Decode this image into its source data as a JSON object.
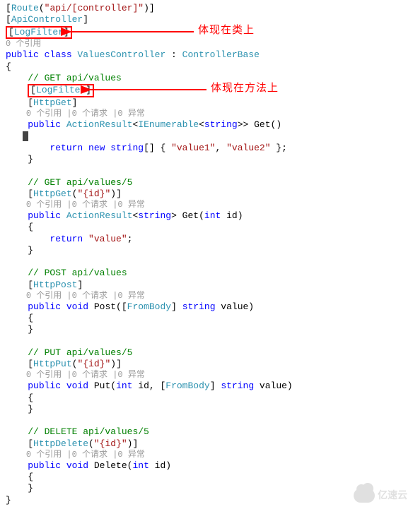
{
  "annotations": {
    "class_level": "体现在类上",
    "method_level": "体现在方法上"
  },
  "watermark": "亿速云",
  "code": {
    "route_attr": "[Route(\"api/[controller]\")]",
    "api_attr_open": "[",
    "api_attr_name": "ApiController",
    "api_attr_close": "]",
    "logfilter_open": "[",
    "logfilter_name": "LogFilter",
    "logfilter_close": "]",
    "refs0": "0 个引用",
    "class_decl_kw": "public class ",
    "class_name": "ValuesController",
    "class_sep": " : ",
    "class_base": "ControllerBase",
    "brace_open": "{",
    "brace_close": "}",
    "cmt_get": "// GET api/values",
    "httpget_open": "[",
    "httpget_name": "HttpGet",
    "httpget_close": "]",
    "refs_req_err": "0 个引用 |0 个请求 |0 异常",
    "get1_sig_pub": "public ",
    "get1_sig_type": "ActionResult",
    "get1_sig_lt": "<",
    "get1_sig_ienum": "IEnumerable",
    "get1_sig_lt2": "<",
    "get1_sig_str": "string",
    "get1_sig_gt": ">> Get()",
    "return_kw": "return ",
    "new_kw": "new ",
    "arr_kw": "string",
    "arr_body": "[] { ",
    "v1": "\"value1\"",
    "comma": ", ",
    "v2": "\"value2\"",
    "arr_end": " };",
    "cmt_get5": "// GET api/values/5",
    "httpget_id_open": "[",
    "httpget_id_name": "HttpGet",
    "httpget_id_par": "(",
    "httpget_id_str": "\"{id}\"",
    "httpget_id_close": ")]",
    "get2_sig_pub": "public ",
    "get2_sig_type": "ActionResult",
    "get2_sig_lt": "<",
    "get2_sig_str": "string",
    "get2_sig_gt": "> Get(",
    "get2_sig_int": "int",
    "get2_sig_end": " id)",
    "ret_value_kw": "return ",
    "ret_value_str": "\"value\"",
    "ret_value_end": ";",
    "cmt_post": "// POST api/values",
    "httppost_open": "[",
    "httppost_name": "HttpPost",
    "httppost_close": "]",
    "post_sig_pub": "public ",
    "post_sig_void": "void",
    "post_sig_name": " Post([",
    "post_sig_frombody": "FromBody",
    "post_sig_br": "] ",
    "post_sig_str": "string",
    "post_sig_end": " value)",
    "cmt_put": "// PUT api/values/5",
    "httpput_open": "[",
    "httpput_name": "HttpPut",
    "httpput_par": "(",
    "httpput_str": "\"{id}\"",
    "httpput_close": ")]",
    "put_sig_pub": "public ",
    "put_sig_void": "void",
    "put_sig_name": " Put(",
    "put_sig_int": "int",
    "put_sig_mid": " id, [",
    "put_sig_frombody": "FromBody",
    "put_sig_br": "] ",
    "put_sig_str": "string",
    "put_sig_end": " value)",
    "cmt_del": "// DELETE api/values/5",
    "httpdel_open": "[",
    "httpdel_name": "HttpDelete",
    "httpdel_par": "(",
    "httpdel_str": "\"{id}\"",
    "httpdel_close": ")]",
    "del_sig_pub": "public ",
    "del_sig_void": "void",
    "del_sig_name": " Delete(",
    "del_sig_int": "int",
    "del_sig_end": " id)"
  }
}
